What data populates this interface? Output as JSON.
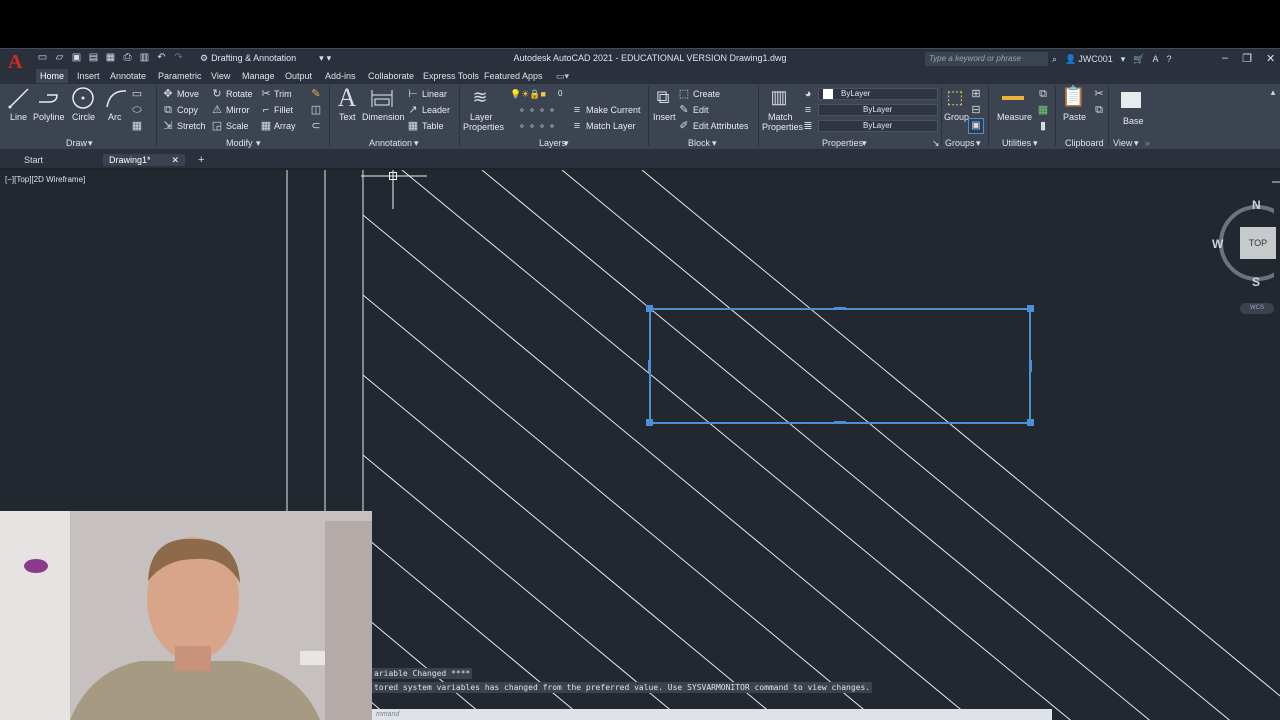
{
  "app": {
    "logo": "A",
    "title": "Autodesk AutoCAD 2021 - EDUCATIONAL VERSION    Drawing1.dwg",
    "workspace": "Drafting & Annotation",
    "search_placeholder": "Type a keyword or phrase",
    "user": "JWC001"
  },
  "menu_tabs": [
    "Home",
    "Insert",
    "Annotate",
    "Parametric",
    "View",
    "Manage",
    "Output",
    "Add-ins",
    "Collaborate",
    "Express Tools",
    "Featured Apps"
  ],
  "ribbon": {
    "draw": {
      "title": "Draw",
      "tools": [
        "Line",
        "Polyline",
        "Circle",
        "Arc"
      ]
    },
    "modify": {
      "title": "Modify",
      "tools": [
        "Move",
        "Rotate",
        "Trim",
        "Copy",
        "Mirror",
        "Fillet",
        "Stretch",
        "Scale",
        "Array"
      ]
    },
    "annotation": {
      "title": "Annotation",
      "tools": [
        "Text",
        "Dimension",
        "Linear",
        "Leader",
        "Table"
      ]
    },
    "layers": {
      "title": "Layers",
      "layer_properties": "Layer Properties",
      "current_layer": "0",
      "make_current": "Make Current",
      "match_layer": "Match Layer"
    },
    "block": {
      "title": "Block",
      "insert": "Insert",
      "create": "Create",
      "edit": "Edit",
      "edit_attributes": "Edit Attributes"
    },
    "properties": {
      "title": "Properties",
      "match_properties": "Match Properties",
      "color": "ByLayer",
      "linetype": "ByLayer",
      "lineweight": "ByLayer"
    },
    "groups": {
      "title": "Groups",
      "group": "Group"
    },
    "utilities": {
      "title": "Utilities",
      "measure": "Measure"
    },
    "clipboard": {
      "title": "Clipboard",
      "paste": "Paste"
    },
    "view": {
      "title": "View",
      "base": "Base"
    }
  },
  "file_tabs": [
    "Start",
    "Drawing1*"
  ],
  "viewport_label": "[−][Top][2D Wireframe]",
  "viewcube": {
    "n": "N",
    "s": "S",
    "w": "W",
    "face": "TOP",
    "wcs": "WCS"
  },
  "command_history": [
    "ariable Changed ****",
    "tored system variables has changed from the preferred value. Use SYSVARMONITOR command to view changes."
  ],
  "command_prompt": "mmand",
  "colors": {
    "canvas": "#212830",
    "ribbon": "#3c4452",
    "selection": "#4d8fd6",
    "titlebar": "#2b313c"
  }
}
